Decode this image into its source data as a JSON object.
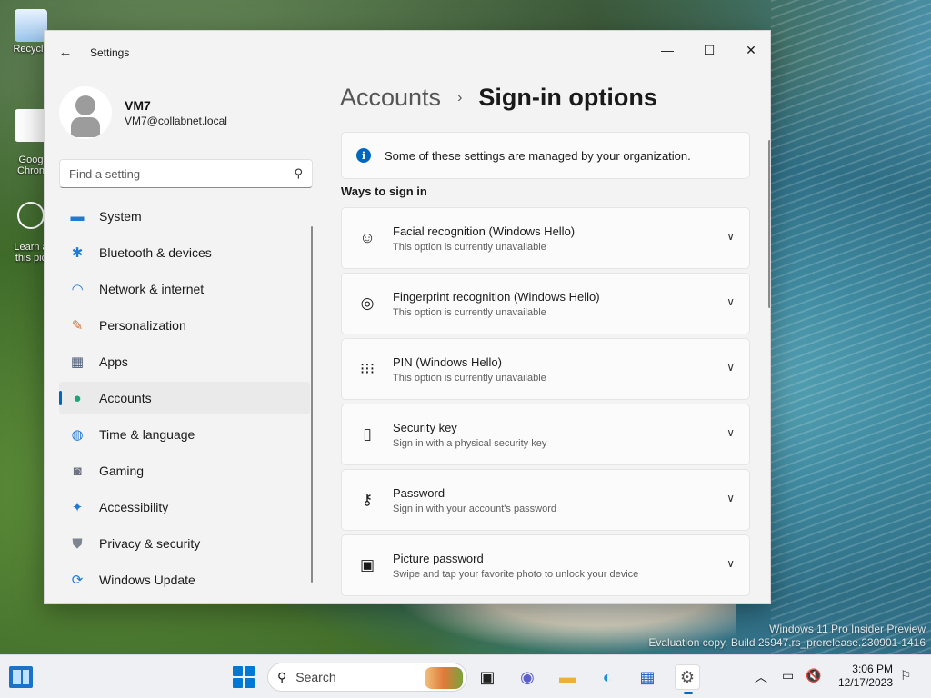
{
  "desktop": {
    "icons": [
      {
        "label": "Recycle"
      },
      {
        "label": "Goog\nChron"
      },
      {
        "label": "Learn a\nthis pic"
      }
    ],
    "watermark_line1": "Windows 11 Pro Insider Preview",
    "watermark_line2": "Evaluation copy. Build 25947.rs_prerelease.230901-1416"
  },
  "window": {
    "title": "Settings",
    "controls": {
      "minimize": "—",
      "maximize": "☐",
      "close": "✕"
    }
  },
  "profile": {
    "name": "VM7",
    "email": "VM7@collabnet.local"
  },
  "search": {
    "placeholder": "Find a setting"
  },
  "nav": {
    "items": [
      {
        "label": "System",
        "icon": "system-icon",
        "glyph": "▬",
        "color": "#1f7ad6"
      },
      {
        "label": "Bluetooth & devices",
        "icon": "bluetooth-icon",
        "glyph": "✱",
        "color": "#1f7ad6"
      },
      {
        "label": "Network & internet",
        "icon": "wifi-icon",
        "glyph": "◠",
        "color": "#1f7ad6"
      },
      {
        "label": "Personalization",
        "icon": "brush-icon",
        "glyph": "✎",
        "color": "#c8743a"
      },
      {
        "label": "Apps",
        "icon": "apps-icon",
        "glyph": "▦",
        "color": "#4a5a78"
      },
      {
        "label": "Accounts",
        "icon": "accounts-icon",
        "glyph": "●",
        "color": "#1fa37a"
      },
      {
        "label": "Time & language",
        "icon": "globe-icon",
        "glyph": "◍",
        "color": "#1f7ad6"
      },
      {
        "label": "Gaming",
        "icon": "gamepad-icon",
        "glyph": "◙",
        "color": "#6b7380"
      },
      {
        "label": "Accessibility",
        "icon": "accessibility-icon",
        "glyph": "✦",
        "color": "#1f7ad6"
      },
      {
        "label": "Privacy & security",
        "icon": "shield-icon",
        "glyph": "⛊",
        "color": "#7d8590"
      },
      {
        "label": "Windows Update",
        "icon": "update-icon",
        "glyph": "⟳",
        "color": "#1f7ad6"
      }
    ],
    "active_index": 5
  },
  "main": {
    "breadcrumb_parent": "Accounts",
    "breadcrumb_sep": "›",
    "page_title": "Sign-in options",
    "banner_text": "Some of these settings are managed by your organization.",
    "section_title": "Ways to sign in",
    "options": [
      {
        "title": "Facial recognition (Windows Hello)",
        "subtitle": "This option is currently unavailable",
        "icon": "face-icon",
        "glyph": "☺"
      },
      {
        "title": "Fingerprint recognition (Windows Hello)",
        "subtitle": "This option is currently unavailable",
        "icon": "fingerprint-icon",
        "glyph": "◎"
      },
      {
        "title": "PIN (Windows Hello)",
        "subtitle": "This option is currently unavailable",
        "icon": "pin-icon",
        "glyph": "⁝⁝⁝"
      },
      {
        "title": "Security key",
        "subtitle": "Sign in with a physical security key",
        "icon": "security-key-icon",
        "glyph": "▯"
      },
      {
        "title": "Password",
        "subtitle": "Sign in with your account's password",
        "icon": "key-icon",
        "glyph": "⚷"
      },
      {
        "title": "Picture password",
        "subtitle": "Swipe and tap your favorite photo to unlock your device",
        "icon": "picture-icon",
        "glyph": "▣"
      }
    ]
  },
  "taskbar": {
    "search_label": "Search",
    "time": "3:06 PM",
    "date": "12/17/2023"
  },
  "colors": {
    "accent": "#0067c0"
  }
}
